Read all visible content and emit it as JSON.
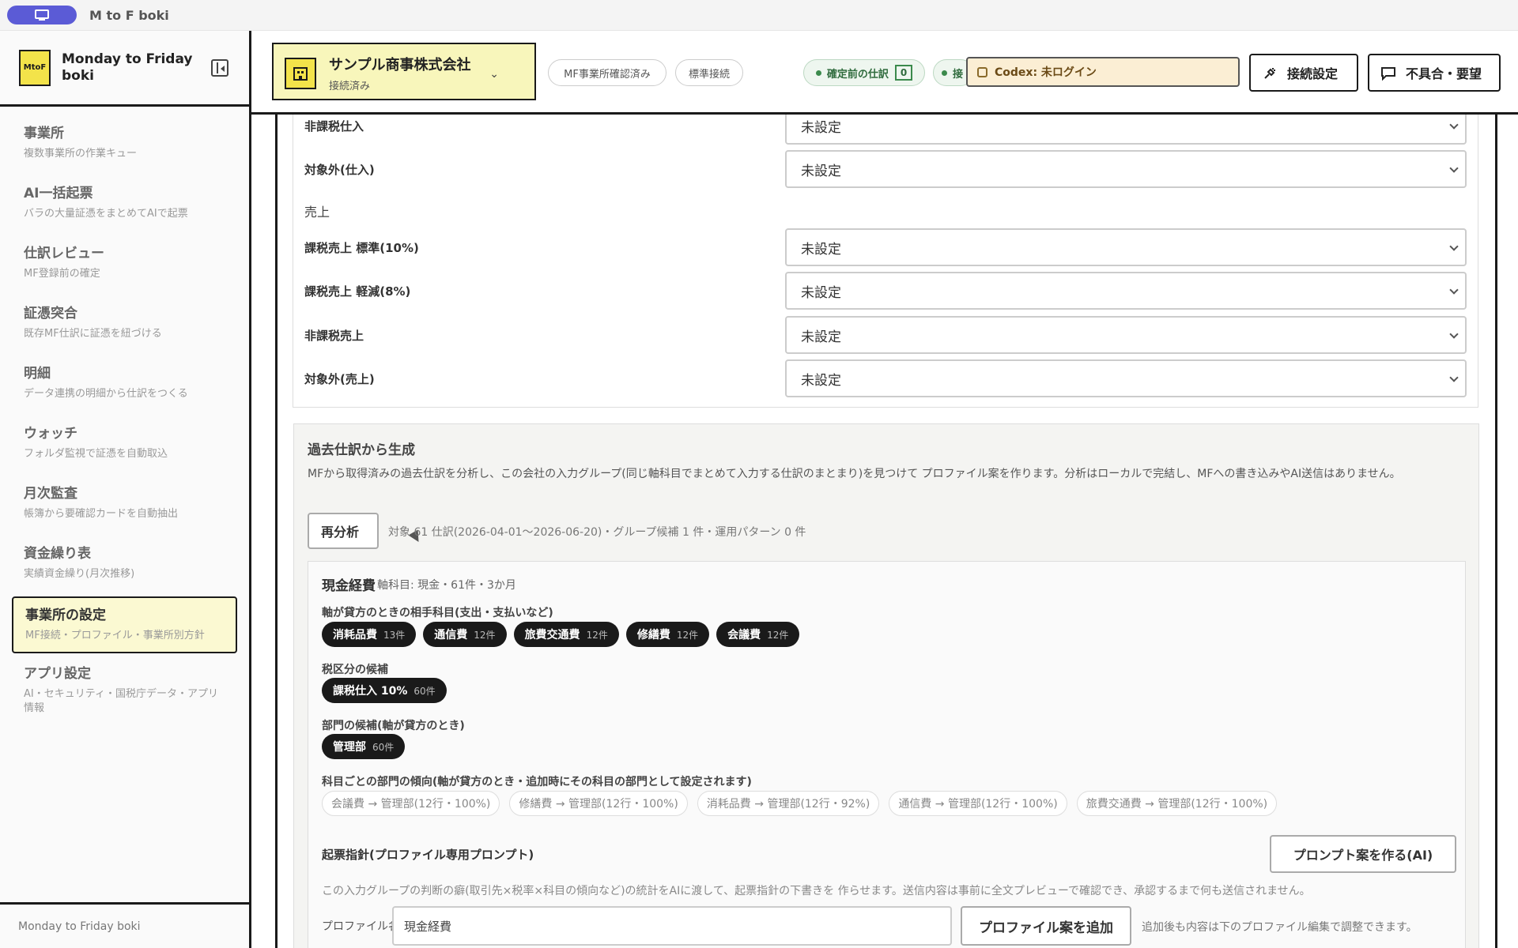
{
  "window": {
    "title": "M to F boki"
  },
  "brand": {
    "logo_text": "MtoF",
    "name": "Monday to Friday boki"
  },
  "sidebar": {
    "items": [
      {
        "title": "事業所",
        "sub": "複数事業所の作業キュー"
      },
      {
        "title": "AI一括起票",
        "sub": "バラの大量証憑をまとめてAIで起票"
      },
      {
        "title": "仕訳レビュー",
        "sub": "MF登録前の確定"
      },
      {
        "title": "証憑突合",
        "sub": "既存MF仕訳に証憑を紐づける"
      },
      {
        "title": "明細",
        "sub": "データ連携の明細から仕訳をつくる"
      },
      {
        "title": "ウォッチ",
        "sub": "フォルダ監視で証憑を自動取込"
      },
      {
        "title": "月次監査",
        "sub": "帳簿から要確認カードを自動抽出"
      },
      {
        "title": "資金繰り表",
        "sub": "実績資金繰り(月次推移)"
      },
      {
        "title": "事業所の設定",
        "sub": "MF接続・プロファイル・事業所別方針"
      },
      {
        "title": "アプリ設定",
        "sub": "AI・セキュリティ・国税庁データ・アプリ情報"
      }
    ],
    "footer": "Monday to Friday boki"
  },
  "header": {
    "company_name": "サンプル商事株式会社",
    "company_status": "接続済み",
    "chips": [
      "MF事業所確認済み",
      "標準接続"
    ],
    "pending_label": "確定前の仕訳",
    "pending_count": "0",
    "truncated_chip": "接",
    "codex": "Codex: 未ログイン",
    "connect_btn": "接続設定",
    "feedback_btn": "不具合・要望"
  },
  "tax_mapping": {
    "purchase_rows": [
      {
        "label": "非課税仕入",
        "value": "未設定"
      },
      {
        "label": "対象外(仕入)",
        "value": "未設定"
      }
    ],
    "sales_header": "売上",
    "sales_rows": [
      {
        "label": "課税売上 標準(10%)",
        "value": "未設定"
      },
      {
        "label": "課税売上 軽減(8%)",
        "value": "未設定"
      },
      {
        "label": "非課税売上",
        "value": "未設定"
      },
      {
        "label": "対象外(売上)",
        "value": "未設定"
      }
    ]
  },
  "generate": {
    "title": "過去仕訳から生成",
    "desc": "MFから取得済みの過去仕訳を分析し、この会社の入力グループ(同じ軸科目でまとめて入力する仕訳のまとまり)を見つけて プロファイル案を作ります。分析はローカルで完結し、MFへの書き込みやAI送信はありません。",
    "reanalyze": "再分析",
    "meta": "対象 61 仕訳(2026-04-01〜2026-06-20)・グループ候補 1 件・運用パターン 0 件",
    "group": {
      "title": "現金経費",
      "sub": "軸科目: 現金・61件・3か月",
      "counter_label": "軸が貸方のときの相手科目(支出・支払いなど)",
      "counter_accounts": [
        {
          "name": "消耗品費",
          "count": "13件"
        },
        {
          "name": "通信費",
          "count": "12件"
        },
        {
          "name": "旅費交通費",
          "count": "12件"
        },
        {
          "name": "修繕費",
          "count": "12件"
        },
        {
          "name": "会議費",
          "count": "12件"
        }
      ],
      "tax_label": "税区分の候補",
      "tax_candidates": [
        {
          "name": "課税仕入 10%",
          "count": "60件"
        }
      ],
      "dept_label": "部門の候補(軸が貸方のとき)",
      "dept_candidates": [
        {
          "name": "管理部",
          "count": "60件"
        }
      ],
      "tendency_label": "科目ごとの部門の傾向(軸が貸方のとき・追加時にその科目の部門として設定されます)",
      "tendencies": [
        "会議費 → 管理部(12行・100%)",
        "修繕費 → 管理部(12行・100%)",
        "消耗品費 → 管理部(12行・92%)",
        "通信費 → 管理部(12行・100%)",
        "旅費交通費 → 管理部(12行・100%)"
      ],
      "policy_label": "起票指針(プロファイル専用プロンプト)",
      "prompt_btn": "プロンプト案を作る(AI)",
      "policy_desc": "この入力グループの判断の癖(取引先×税率×科目の傾向など)の統計をAIに渡して、起票指針の下書きを 作らせます。送信内容は事前に全文プレビューで確認でき、承認するまで何も送信されません。",
      "profile_name_label": "プロファイル名",
      "profile_name_value": "現金経費",
      "add_btn": "プロファイル案を追加",
      "add_note": "追加後も内容は下のプロファイル編集で調整できます。"
    }
  }
}
